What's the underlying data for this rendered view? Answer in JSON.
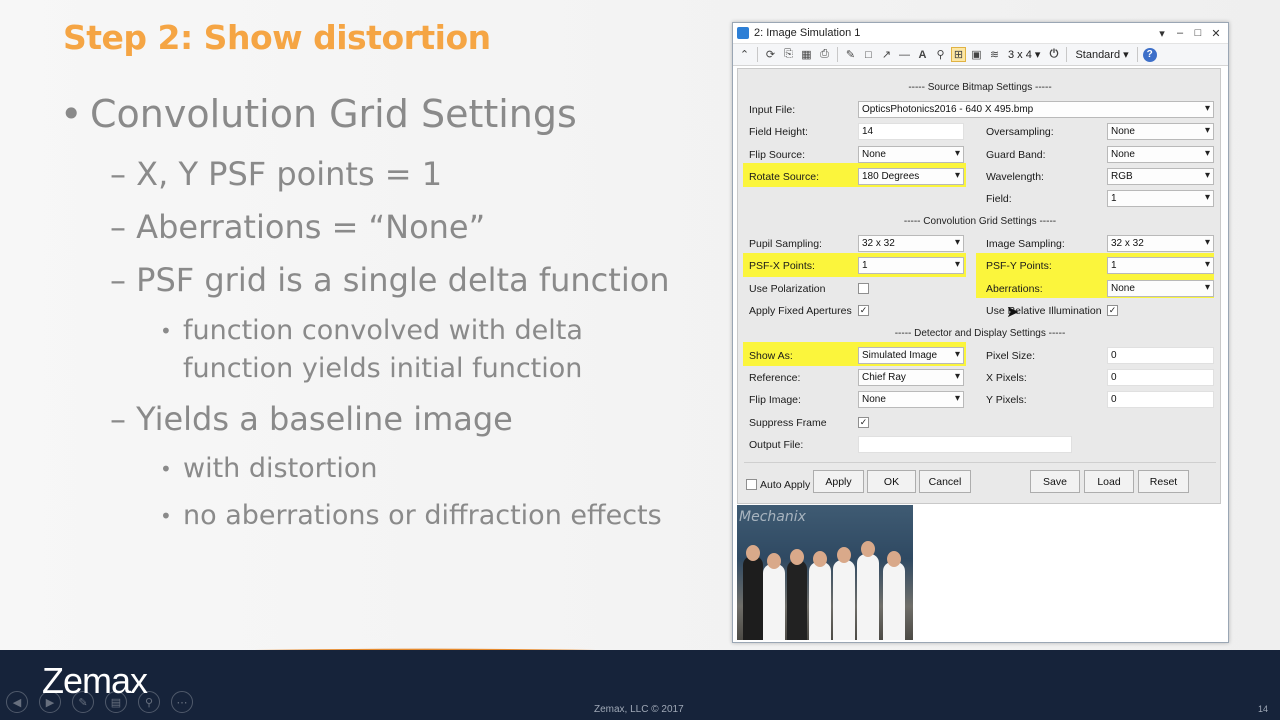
{
  "slide": {
    "title": "Step 2: Show distortion",
    "bullets": {
      "main": "Convolution Grid Settings",
      "sub1": "– X, Y PSF points = 1",
      "sub2": "– Aberrations = “None”",
      "sub3": "– PSF grid is a single delta function",
      "sub3_detail_line1": "function convolved with delta",
      "sub3_detail_line2": "function yields initial function",
      "sub4": "– Yields a baseline image",
      "sub4_detail1": "with distortion",
      "sub4_detail2": "no aberrations or diffraction effects"
    },
    "bullet_glyph": "•",
    "footer_logo": "Zemax",
    "copyright": "Zemax, LLC © 2017",
    "page_number": "14"
  },
  "window": {
    "title": "2: Image Simulation 1",
    "toolbar": {
      "layout_label": "3 x 4 ▾",
      "standard_label": "Standard ▾"
    },
    "sections": {
      "source": "----- Source Bitmap Settings -----",
      "convolution": "----- Convolution Grid Settings -----",
      "detector": "----- Detector and Display Settings -----"
    },
    "fields": {
      "input_file": {
        "label": "Input File:",
        "value": "OpticsPhotonics2016 - 640 X 495.bmp"
      },
      "field_height": {
        "label": "Field Height:",
        "value": "14"
      },
      "oversampling": {
        "label": "Oversampling:",
        "value": "None"
      },
      "flip_source": {
        "label": "Flip Source:",
        "value": "None"
      },
      "guard_band": {
        "label": "Guard Band:",
        "value": "None"
      },
      "rotate_source": {
        "label": "Rotate Source:",
        "value": "180 Degrees"
      },
      "wavelength": {
        "label": "Wavelength:",
        "value": "RGB"
      },
      "field": {
        "label": "Field:",
        "value": "1"
      },
      "pupil_sampling": {
        "label": "Pupil Sampling:",
        "value": "32 x 32"
      },
      "image_sampling": {
        "label": "Image Sampling:",
        "value": "32 x 32"
      },
      "psf_x": {
        "label": "PSF-X Points:",
        "value": "1"
      },
      "psf_y": {
        "label": "PSF-Y Points:",
        "value": "1"
      },
      "use_polarization": {
        "label": "Use Polarization",
        "checked": ""
      },
      "aberrations": {
        "label": "Aberrations:",
        "value": "None"
      },
      "apply_fixed": {
        "label": "Apply Fixed Apertures",
        "checked": "✓"
      },
      "relative_illum": {
        "label": "Use Relative Illumination",
        "checked": "✓"
      },
      "show_as": {
        "label": "Show As:",
        "value": "Simulated Image"
      },
      "pixel_size": {
        "label": "Pixel Size:",
        "value": "0"
      },
      "reference": {
        "label": "Reference:",
        "value": "Chief Ray"
      },
      "x_pixels": {
        "label": "X Pixels:",
        "value": "0"
      },
      "flip_image": {
        "label": "Flip Image:",
        "value": "None"
      },
      "y_pixels": {
        "label": "Y Pixels:",
        "value": "0"
      },
      "suppress_frame": {
        "label": "Suppress Frame",
        "checked": "✓"
      },
      "output_file": {
        "label": "Output File:",
        "value": ""
      }
    },
    "buttons": {
      "auto_apply": "Auto Apply",
      "apply": "Apply",
      "ok": "OK",
      "cancel": "Cancel",
      "save": "Save",
      "load": "Load",
      "reset": "Reset"
    },
    "thumbnail_brand": "Mechanix"
  },
  "colors": {
    "title_orange": "#f5a544",
    "highlight_yellow": "#fbf53c",
    "footer_navy": "#16233a"
  }
}
